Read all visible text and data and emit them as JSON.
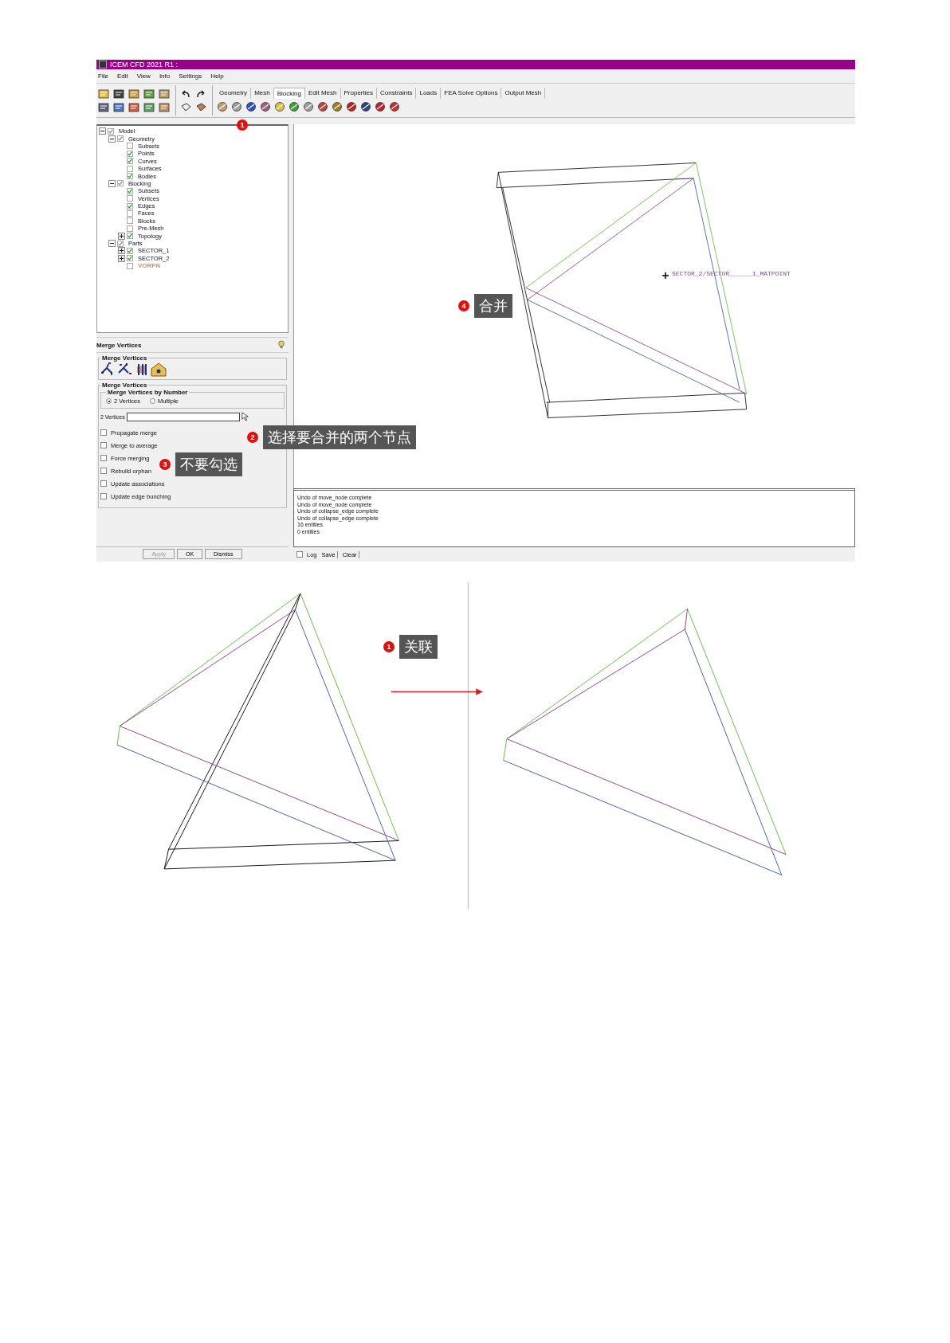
{
  "window": {
    "title": "ICEM CFD 2021 R1 :"
  },
  "menu": [
    "File",
    "Edit",
    "View",
    "Info",
    "Settings",
    "Help"
  ],
  "ribbon_tabs": [
    {
      "label": "Geometry",
      "selected": false
    },
    {
      "label": "Mesh",
      "selected": false
    },
    {
      "label": "Blocking",
      "selected": true
    },
    {
      "label": "Edit Mesh",
      "selected": false
    },
    {
      "label": "Properties",
      "selected": false
    },
    {
      "label": "Constraints",
      "selected": false
    },
    {
      "label": "Loads",
      "selected": false
    },
    {
      "label": "FEA Solve Options",
      "selected": false
    },
    {
      "label": "Output Mesh",
      "selected": false
    }
  ],
  "tree": [
    {
      "label": "Model",
      "checked": true,
      "expanded": true,
      "children": [
        {
          "label": "Geometry",
          "checked": true,
          "expanded": true,
          "children": [
            {
              "label": "Subsets",
              "checked": false
            },
            {
              "label": "Points",
              "checked": true
            },
            {
              "label": "Curves",
              "checked": true
            },
            {
              "label": "Surfaces",
              "checked": false
            },
            {
              "label": "Bodies",
              "checked": true
            }
          ]
        },
        {
          "label": "Blocking",
          "checked": true,
          "expanded": true,
          "children": [
            {
              "label": "Subsets",
              "checked": true
            },
            {
              "label": "Vertices",
              "checked": false
            },
            {
              "label": "Edges",
              "checked": true
            },
            {
              "label": "Faces",
              "checked": false
            },
            {
              "label": "Blocks",
              "checked": false
            },
            {
              "label": "Pre-Mesh",
              "checked": false
            },
            {
              "label": "Topology",
              "checked": true,
              "expanded": false
            }
          ]
        },
        {
          "label": "Parts",
          "checked": true,
          "expanded": true,
          "children": [
            {
              "label": "SECTOR_1",
              "checked": true,
              "expanded": false
            },
            {
              "label": "SECTOR_2",
              "checked": true,
              "expanded": false
            },
            {
              "label": "VORFN",
              "checked": false,
              "color": "#d09060"
            }
          ]
        }
      ]
    }
  ],
  "panel": {
    "title": "Merge Vertices",
    "group_title": "Merge Vertices",
    "section_title": "Merge Vertices",
    "subsection_title": "Merge Vertices by Number",
    "radios": [
      {
        "label": "2 Vertices",
        "selected": true
      },
      {
        "label": "Multiple",
        "selected": false
      }
    ],
    "field_label": "2 Vertices",
    "options": [
      {
        "label": "Propagate merge",
        "checked": false
      },
      {
        "label": "Merge to average",
        "checked": false
      },
      {
        "label": "Force merging",
        "checked": false
      },
      {
        "label": "Rebuild orphan",
        "checked": false
      },
      {
        "label": "Update associations",
        "checked": false
      },
      {
        "label": "Update edge bunching",
        "checked": false
      }
    ],
    "buttons": [
      "Apply",
      "OK",
      "Dismiss"
    ]
  },
  "viewport": {
    "label": "SECTOR_2/SECTOR______1_MATPOINT"
  },
  "log": {
    "lines": [
      "Undo of move_node complete",
      "Undo of move_node complete",
      "Undo of collapse_edge complete",
      "Undo of collapse_edge complete",
      "16 entities",
      "0 entities"
    ],
    "log_label": "Log",
    "log_checked": false,
    "buttons": [
      "Save",
      "Clear"
    ]
  },
  "callouts": [
    {
      "number": "1"
    },
    {
      "number": "2",
      "text": "选择要合并的两个节点"
    },
    {
      "number": "3",
      "text": "不要勾选"
    },
    {
      "number": "4",
      "text": "合并"
    },
    {
      "number": "1",
      "text": "关联"
    }
  ]
}
